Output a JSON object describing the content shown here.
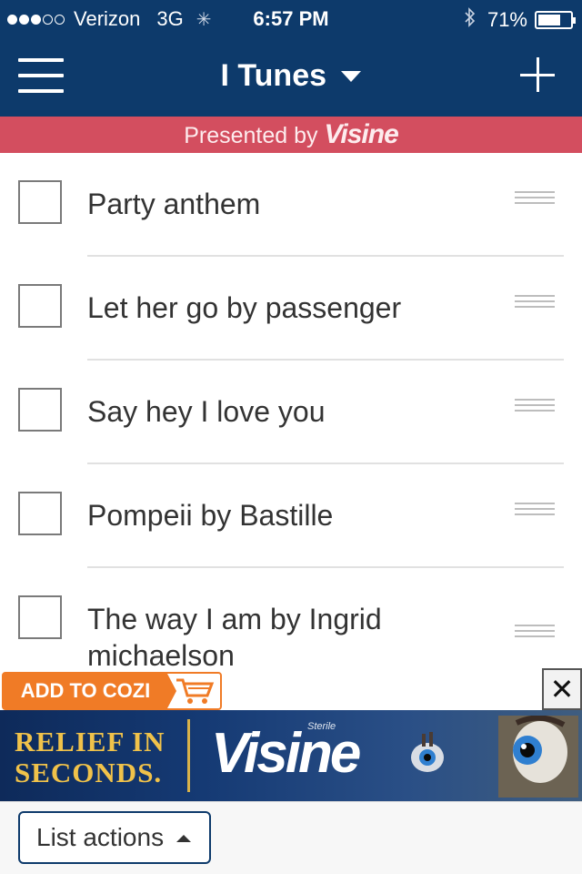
{
  "status_bar": {
    "signal_bars_filled": 3,
    "signal_bars_total": 5,
    "carrier": "Verizon",
    "network": "3G",
    "time": "6:57 PM",
    "battery_percent_label": "71%",
    "battery_level": 0.71
  },
  "nav": {
    "title": "I Tunes"
  },
  "sponsor": {
    "prefix": "Presented by",
    "brand": "Visine"
  },
  "list": {
    "items": [
      {
        "label": "Party anthem",
        "checked": false
      },
      {
        "label": "Let her go by passenger",
        "checked": false
      },
      {
        "label": "Say hey I love you",
        "checked": false
      },
      {
        "label": "Pompeii by Bastille",
        "checked": false
      },
      {
        "label": "The way I am by Ingrid michaelson",
        "checked": false
      }
    ]
  },
  "ad": {
    "add_to_cozi_label": "ADD TO COZI",
    "close_glyph": "✕",
    "headline_line1": "RELIEF IN",
    "headline_line2": "SECONDS.",
    "brand": "Visine",
    "brand_sub": "Sterile"
  },
  "toolbar": {
    "list_actions_label": "List actions"
  },
  "colors": {
    "nav_blue": "#0d3a6b",
    "sponsor_red": "#d34e5f",
    "cozi_orange": "#f07b26",
    "ad_gold": "#f0c24a"
  },
  "icons": [
    "menu-icon",
    "dropdown-caret-icon",
    "plus-icon",
    "bluetooth-icon",
    "battery-icon",
    "drag-handle-icon",
    "cart-icon",
    "close-icon",
    "caret-up-icon"
  ]
}
